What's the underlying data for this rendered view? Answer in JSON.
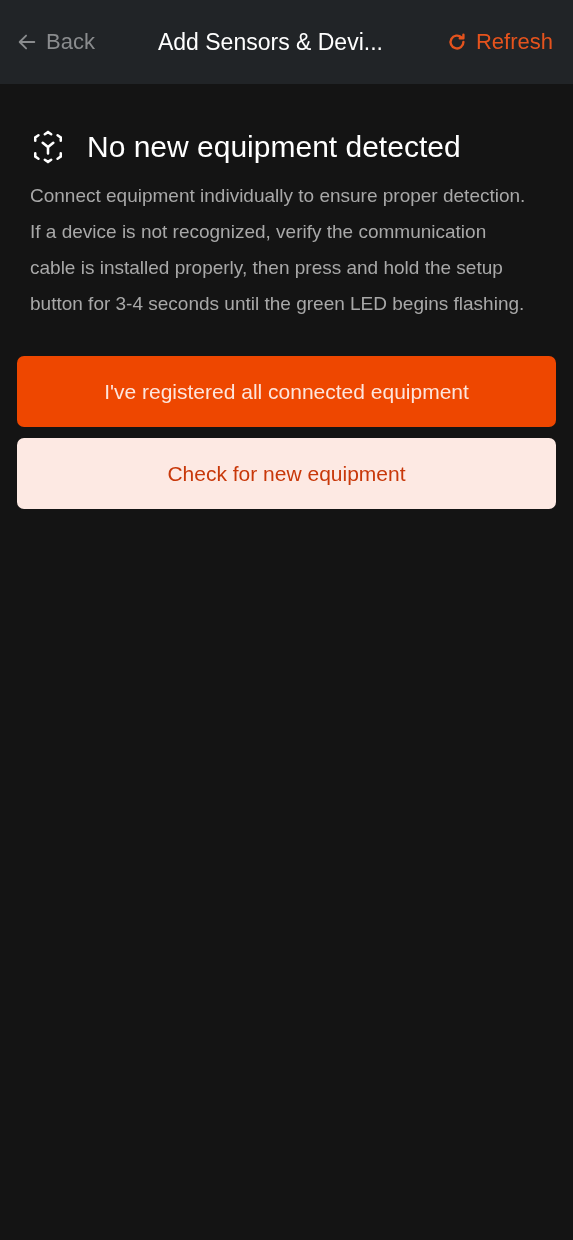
{
  "header": {
    "back": "Back",
    "title": "Add Sensors & Devi...",
    "refresh": "Refresh"
  },
  "status": {
    "title": "No new equipment detected",
    "message": "Connect equipment individually to ensure proper detection. If a device is not recognized, verify the communication cable is installed properly, then press and hold the setup button for 3-4 seconds until the green LED begins flashing."
  },
  "buttons": [
    {
      "label": "I've registered all connected equipment",
      "kind": "primary"
    },
    {
      "label": "Check for new equipment",
      "kind": "secondary"
    }
  ]
}
